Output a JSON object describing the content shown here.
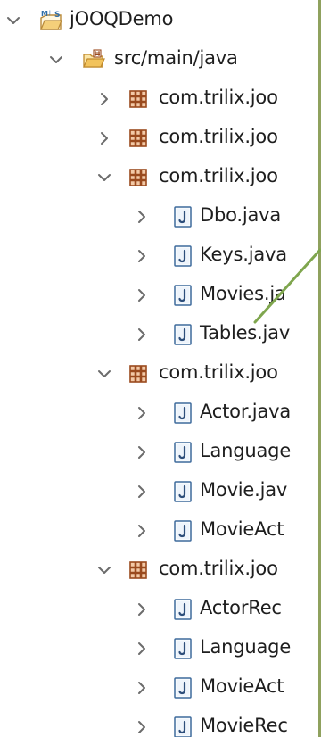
{
  "tree": {
    "project": {
      "label": "jOOQDemo",
      "icon": "java-project-icon",
      "state": "expanded"
    },
    "source_folder": {
      "label": "src/main/java",
      "icon": "source-folder-icon",
      "state": "expanded"
    },
    "packages": [
      {
        "label": "com.trilix.joo",
        "icon": "package-icon",
        "state": "collapsed",
        "files": []
      },
      {
        "label": "com.trilix.joo",
        "icon": "package-icon",
        "state": "collapsed",
        "files": []
      },
      {
        "label": "com.trilix.joo",
        "icon": "package-icon",
        "state": "expanded",
        "files": [
          {
            "label": "Dbo.java",
            "icon": "java-file-icon"
          },
          {
            "label": "Keys.java",
            "icon": "java-file-icon"
          },
          {
            "label": "Movies.ja",
            "icon": "java-file-icon"
          },
          {
            "label": "Tables.jav",
            "icon": "java-file-icon"
          }
        ]
      },
      {
        "label": "com.trilix.joo",
        "icon": "package-icon",
        "state": "expanded",
        "files": [
          {
            "label": "Actor.java",
            "icon": "java-file-icon"
          },
          {
            "label": "Language",
            "icon": "java-file-icon"
          },
          {
            "label": "Movie.jav",
            "icon": "java-file-icon"
          },
          {
            "label": "MovieAct",
            "icon": "java-file-icon"
          }
        ]
      },
      {
        "label": "com.trilix.joo",
        "icon": "package-icon",
        "state": "expanded",
        "files": [
          {
            "label": "ActorRec",
            "icon": "java-file-icon"
          },
          {
            "label": "Language",
            "icon": "java-file-icon"
          },
          {
            "label": "MovieAct",
            "icon": "java-file-icon"
          },
          {
            "label": "MovieRec",
            "icon": "java-file-icon"
          }
        ]
      }
    ]
  },
  "colors": {
    "background": "#ffffff",
    "text": "#1e1e1e",
    "chevron": "#6b6b6b",
    "package_icon": "#9a4a1e",
    "java_file_icon_border": "#3d6a9c",
    "folder_icon": "#e2a84b",
    "edge_line": "#8fa15e",
    "annotation_line": "#7fa64e"
  }
}
